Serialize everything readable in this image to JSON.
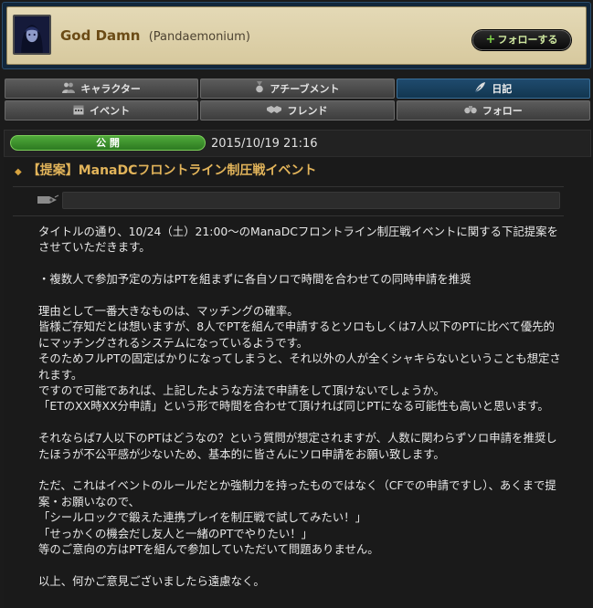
{
  "character": {
    "name": "God Damn",
    "world": "(Pandaemonium)",
    "follow_button": "+フォローする",
    "follow_plus": "+",
    "follow_label": "フォローする"
  },
  "tabs": {
    "row1": [
      {
        "label": "キャラクター",
        "icon": "people-icon"
      },
      {
        "label": "アチーブメント",
        "icon": "medal-icon"
      },
      {
        "label": "日記",
        "icon": "quill-icon",
        "active": true
      }
    ],
    "row2": [
      {
        "label": "イベント",
        "icon": "calendar-icon"
      },
      {
        "label": "フレンド",
        "icon": "handshake-icon"
      },
      {
        "label": "フォロー",
        "icon": "binoculars-icon"
      }
    ]
  },
  "entry": {
    "visibility": "公 開",
    "date": "2015/10/19 21:16",
    "title": "【提案】ManaDCフロントライン制圧戦イベント",
    "paragraphs": [
      [
        "タイトルの通り、10/24（土）21:00～のManaDCフロントライン制圧戦イベントに関する下記提案をさせていただきます。"
      ],
      [
        "・複数人で参加予定の方はPTを組まずに各自ソロで時間を合わせての同時申請を推奨"
      ],
      [
        "理由として一番大きなものは、マッチングの確率。",
        "皆様ご存知だとは想いますが、8人でPTを組んで申請するとソロもしくは7人以下のPTに比べて優先的にマッチングされるシステムになっているようです。",
        "そのためフルPTの固定ばかりになってしまうと、それ以外の人が全くシャキらないということも想定されます。",
        "ですので可能であれば、上記したような方法で申請をして頂けないでしょうか。",
        "「ETのXX時XX分申請」という形で時間を合わせて頂ければ同じPTになる可能性も高いと思います。"
      ],
      [
        "それならば7人以下のPTはどうなの？という質問が想定されますが、人数に関わらずソロ申請を推奨したほうが不公平感が少ないため、基本的に皆さんにソロ申請をお願い致します。"
      ],
      [
        "ただ、これはイベントのルールだとか強制力を持ったものではなく（CFでの申請ですし）、あくまで提案・お願いなので、",
        "「シールロックで鍛えた連携プレイを制圧戦で試してみたい！」",
        "「せっかくの機会だし友人と一緒のPTでやりたい！」",
        "等のご意向の方はPTを組んで参加していただいて問題ありません。"
      ],
      [
        "以上、何かご意見ございましたら遠慮なく。"
      ]
    ]
  },
  "colors": {
    "accent_title": "#e2b45a",
    "name_color": "#6b4b16",
    "public_green": "#3f9a2f",
    "active_tab": "#1f4b6e"
  }
}
